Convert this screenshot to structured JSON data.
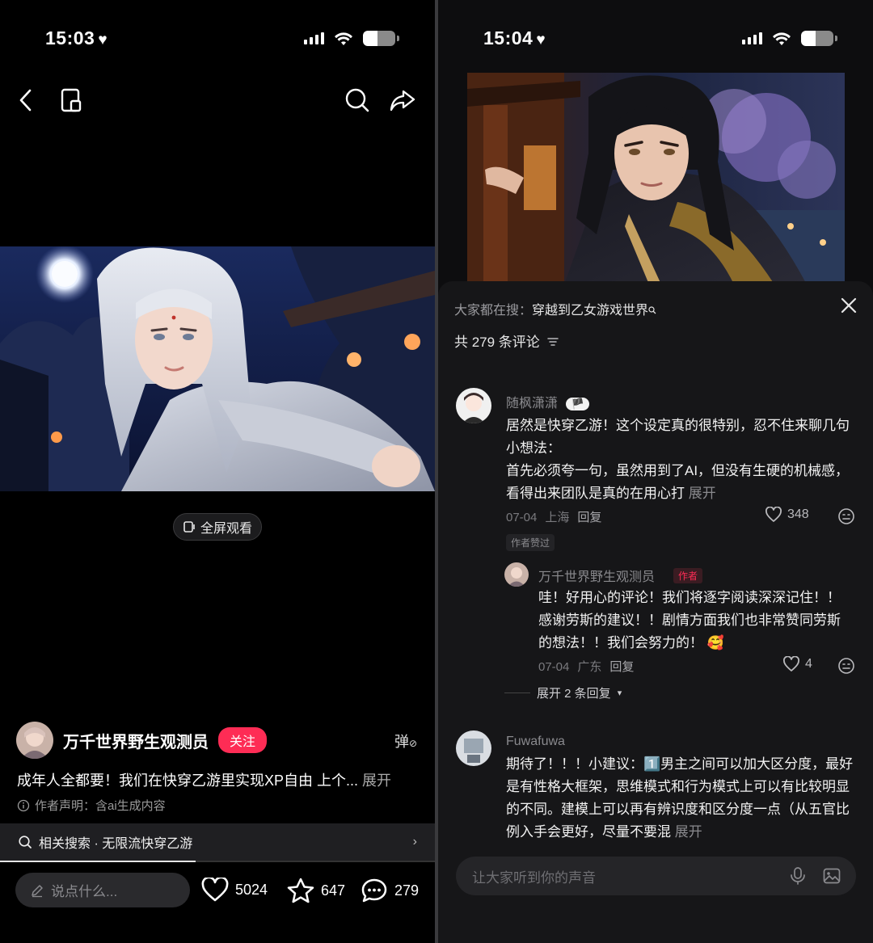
{
  "left": {
    "status": {
      "time": "15:03",
      "heart": "♥"
    },
    "fullscreen_label": "全屏观看",
    "author": {
      "name": "万千世界野生观测员",
      "follow_label": "关注"
    },
    "danmu_label": "弹",
    "caption": {
      "text": "成年人全都要！我们在快穿乙游里实现XP自由 上个...",
      "more": "展开"
    },
    "disclaimer": "作者声明：含ai生成内容",
    "related": {
      "label": "相关搜索 · 无限流快穿乙游",
      "progress": 0.45
    },
    "input_placeholder": "说点什么...",
    "actions": {
      "likes": "5024",
      "favorites": "647",
      "comments": "279"
    }
  },
  "right": {
    "status": {
      "time": "15:04",
      "heart": "♥"
    },
    "hot_search": {
      "prefix": "大家都在搜：",
      "term": "穿越到乙女游戏世界"
    },
    "comment_count": "共 279 条评论",
    "comments": [
      {
        "user": "随枫潇潇",
        "badge": "🏴",
        "body": "居然是快穿乙游！这个设定真的很特别，忍不住来聊几句小想法：",
        "body2": " 首先必须夸一句，虽然用到了AI，但没有生硬的机械感，看得出来团队是真的在用心打",
        "more": "展开",
        "date": "07-04",
        "location": "上海",
        "reply": "回复",
        "likes": "348",
        "author_liked": "作者赞过"
      },
      {
        "user": "万千世界野生观测员",
        "tag": "作者",
        "body": "哇！好用心的评论！我们将逐字阅读深深记住！！感谢劳斯的建议！！剧情方面我们也非常赞同劳斯的想法！！我们会努力的！",
        "date": "07-04",
        "location": "广东",
        "reply": "回复",
        "likes": "4"
      },
      {
        "user": "Fuwafuwa",
        "body": "期待了！！！小建议：1️⃣男主之间可以加大区分度，最好是有性格大框架，思维模式和行为模式上可以有比较明显的不同。建模上可以再有辨识度和区分度一点（从五官比例入手会更好，尽量不要混",
        "more": "展开"
      }
    ],
    "expand_replies": "展开 2 条回复",
    "input_placeholder": "让大家听到你的声音"
  },
  "colors": {
    "accent": "#fe2c55",
    "background": "#000000",
    "sheet": "#161618"
  }
}
